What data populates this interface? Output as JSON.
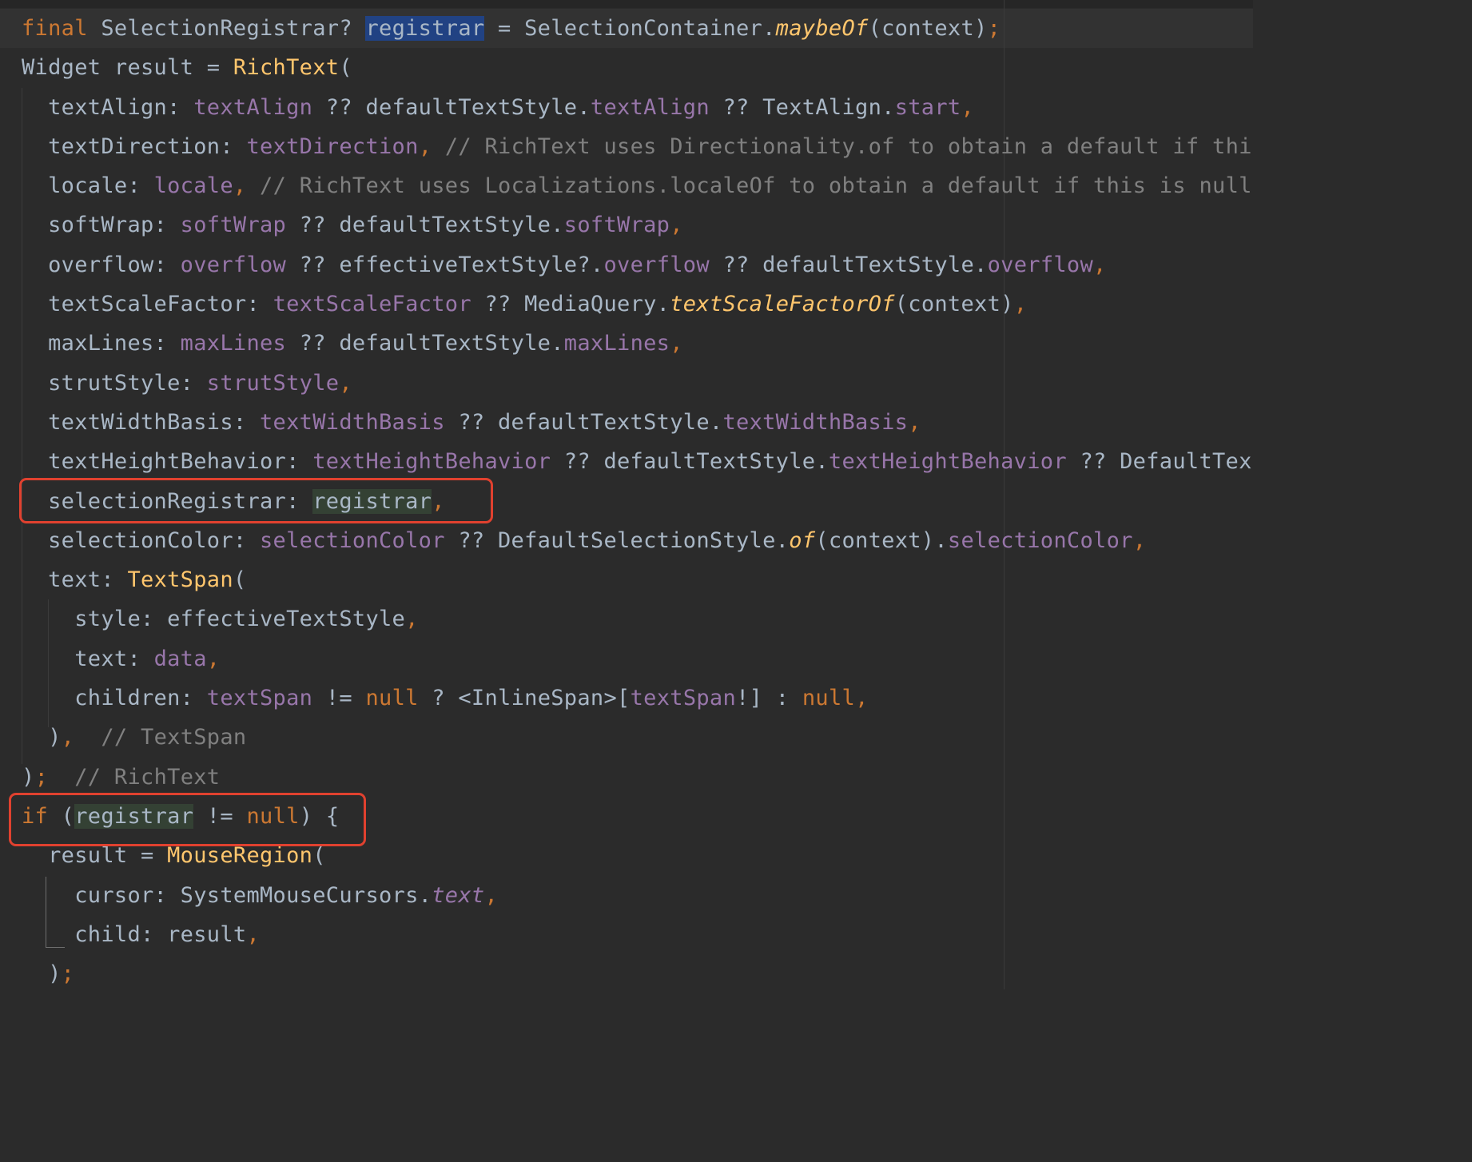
{
  "editor": {
    "lines": [
      [
        {
          "t": "final",
          "c": "kw"
        },
        {
          "t": " SelectionRegistrar? "
        },
        {
          "t": "registrar",
          "c": "sel"
        },
        {
          "t": " = SelectionContainer."
        },
        {
          "t": "maybeOf",
          "c": "ital"
        },
        {
          "t": "(context)"
        },
        {
          "t": ";",
          "c": "kw"
        }
      ],
      [
        {
          "t": "Widget result = "
        },
        {
          "t": "RichText",
          "c": "fn"
        },
        {
          "t": "("
        }
      ],
      [
        {
          "t": "  textAlign: "
        },
        {
          "t": "textAlign",
          "c": "prop"
        },
        {
          "t": " ?? defaultTextStyle."
        },
        {
          "t": "textAlign",
          "c": "prop"
        },
        {
          "t": " ?? TextAlign."
        },
        {
          "t": "start",
          "c": "prop"
        },
        {
          "t": ",",
          "c": "kw"
        }
      ],
      [
        {
          "t": "  textDirection: "
        },
        {
          "t": "textDirection",
          "c": "prop"
        },
        {
          "t": ", ",
          "c": "kw"
        },
        {
          "t": "// RichText uses Directionality.of to obtain a default if this",
          "c": "cm"
        }
      ],
      [
        {
          "t": "  locale: "
        },
        {
          "t": "locale",
          "c": "prop"
        },
        {
          "t": ", ",
          "c": "kw"
        },
        {
          "t": "// RichText uses Localizations.localeOf to obtain a default if this is null",
          "c": "cm"
        }
      ],
      [
        {
          "t": "  softWrap: "
        },
        {
          "t": "softWrap",
          "c": "prop"
        },
        {
          "t": " ?? defaultTextStyle."
        },
        {
          "t": "softWrap",
          "c": "prop"
        },
        {
          "t": ",",
          "c": "kw"
        }
      ],
      [
        {
          "t": "  overflow: "
        },
        {
          "t": "overflow",
          "c": "prop"
        },
        {
          "t": " ?? effectiveTextStyle?."
        },
        {
          "t": "overflow",
          "c": "prop"
        },
        {
          "t": " ?? defaultTextStyle."
        },
        {
          "t": "overflow",
          "c": "prop"
        },
        {
          "t": ",",
          "c": "kw"
        }
      ],
      [
        {
          "t": "  textScaleFactor: "
        },
        {
          "t": "textScaleFactor",
          "c": "prop"
        },
        {
          "t": " ?? MediaQuery."
        },
        {
          "t": "textScaleFactorOf",
          "c": "ital"
        },
        {
          "t": "(context)"
        },
        {
          "t": ",",
          "c": "kw"
        }
      ],
      [
        {
          "t": "  maxLines: "
        },
        {
          "t": "maxLines",
          "c": "prop"
        },
        {
          "t": " ?? defaultTextStyle."
        },
        {
          "t": "maxLines",
          "c": "prop"
        },
        {
          "t": ",",
          "c": "kw"
        }
      ],
      [
        {
          "t": "  strutStyle: "
        },
        {
          "t": "strutStyle",
          "c": "prop"
        },
        {
          "t": ",",
          "c": "kw"
        }
      ],
      [
        {
          "t": "  textWidthBasis: "
        },
        {
          "t": "textWidthBasis",
          "c": "prop"
        },
        {
          "t": " ?? defaultTextStyle."
        },
        {
          "t": "textWidthBasis",
          "c": "prop"
        },
        {
          "t": ",",
          "c": "kw"
        }
      ],
      [
        {
          "t": "  textHeightBehavior: "
        },
        {
          "t": "textHeightBehavior",
          "c": "prop"
        },
        {
          "t": " ?? defaultTextStyle."
        },
        {
          "t": "textHeightBehavior",
          "c": "prop"
        },
        {
          "t": " ?? DefaultTextH"
        }
      ],
      [
        {
          "t": "  selectionRegistrar: "
        },
        {
          "t": "registrar",
          "c": "hl"
        },
        {
          "t": ",",
          "c": "kw"
        }
      ],
      [
        {
          "t": "  selectionColor: "
        },
        {
          "t": "selectionColor",
          "c": "prop"
        },
        {
          "t": " ?? DefaultSelectionStyle."
        },
        {
          "t": "of",
          "c": "ital"
        },
        {
          "t": "(context)."
        },
        {
          "t": "selectionColor",
          "c": "prop"
        },
        {
          "t": ",",
          "c": "kw"
        }
      ],
      [
        {
          "t": "  text: "
        },
        {
          "t": "TextSpan",
          "c": "fn"
        },
        {
          "t": "("
        }
      ],
      [
        {
          "t": "    style: effectiveTextStyle"
        },
        {
          "t": ",",
          "c": "kw"
        }
      ],
      [
        {
          "t": "    text: "
        },
        {
          "t": "data",
          "c": "prop"
        },
        {
          "t": ",",
          "c": "kw"
        }
      ],
      [
        {
          "t": "    children: "
        },
        {
          "t": "textSpan",
          "c": "prop"
        },
        {
          "t": " != "
        },
        {
          "t": "null",
          "c": "kw"
        },
        {
          "t": " ? <InlineSpan>["
        },
        {
          "t": "textSpan",
          "c": "prop"
        },
        {
          "t": "!] : "
        },
        {
          "t": "null",
          "c": "kw"
        },
        {
          "t": ",",
          "c": "kw"
        }
      ],
      [
        {
          "t": "  )"
        },
        {
          "t": ",",
          "c": "kw"
        },
        {
          "t": "  "
        },
        {
          "t": "// TextSpan",
          "c": "cm"
        }
      ],
      [
        {
          "t": ")"
        },
        {
          "t": ";",
          "c": "kw"
        },
        {
          "t": "  "
        },
        {
          "t": "// RichText",
          "c": "cm"
        }
      ],
      [
        {
          "t": "if",
          "c": "kw"
        },
        {
          "t": " ("
        },
        {
          "t": "registrar",
          "c": "hl"
        },
        {
          "t": " != "
        },
        {
          "t": "null",
          "c": "kw"
        },
        {
          "t": ") {"
        }
      ],
      [
        {
          "t": "  result = "
        },
        {
          "t": "MouseRegion",
          "c": "fn"
        },
        {
          "t": "("
        }
      ],
      [
        {
          "t": "    cursor: SystemMouseCursors."
        },
        {
          "t": "text",
          "c": "stat"
        },
        {
          "t": ",",
          "c": "kw"
        }
      ],
      [
        {
          "t": "    child: result"
        },
        {
          "t": ",",
          "c": "kw"
        }
      ],
      [
        {
          "t": "  )"
        },
        {
          "t": ";",
          "c": "kw"
        }
      ]
    ]
  }
}
